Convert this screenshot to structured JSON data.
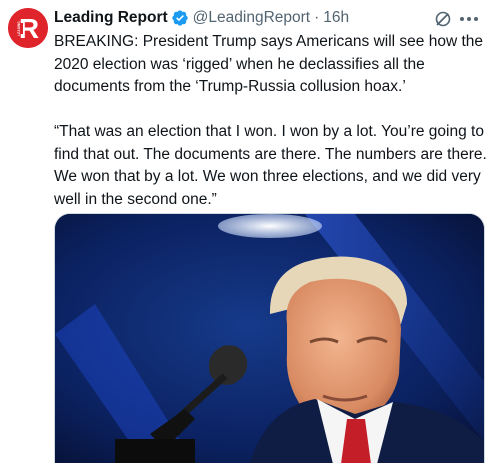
{
  "tweet": {
    "author_name": "Leading Report",
    "handle": "@LeadingReport",
    "separator": "·",
    "time": "16h",
    "avatar_letter": "R",
    "avatar_small_text": "LEADING",
    "verified": true,
    "text": "BREAKING: President Trump says Americans will see how the 2020 election was ‘rigged’ when he declassifies all the documents from the ‘Trump-Russia collusion hoax.’\n\n“That was an election that I won. I won by a lot. You’re going to find that out. The documents are there. The numbers are there. We won that by a lot. We won three elections, and we did very well in the second one.”"
  },
  "icons": {
    "verified": "verified-badge-icon",
    "grok": "grok-icon",
    "more": "more-options-icon"
  },
  "colors": {
    "brand_red": "#e0242b",
    "verified_blue": "#1d9bf0",
    "secondary_text": "#536471",
    "primary_text": "#0f1419"
  }
}
